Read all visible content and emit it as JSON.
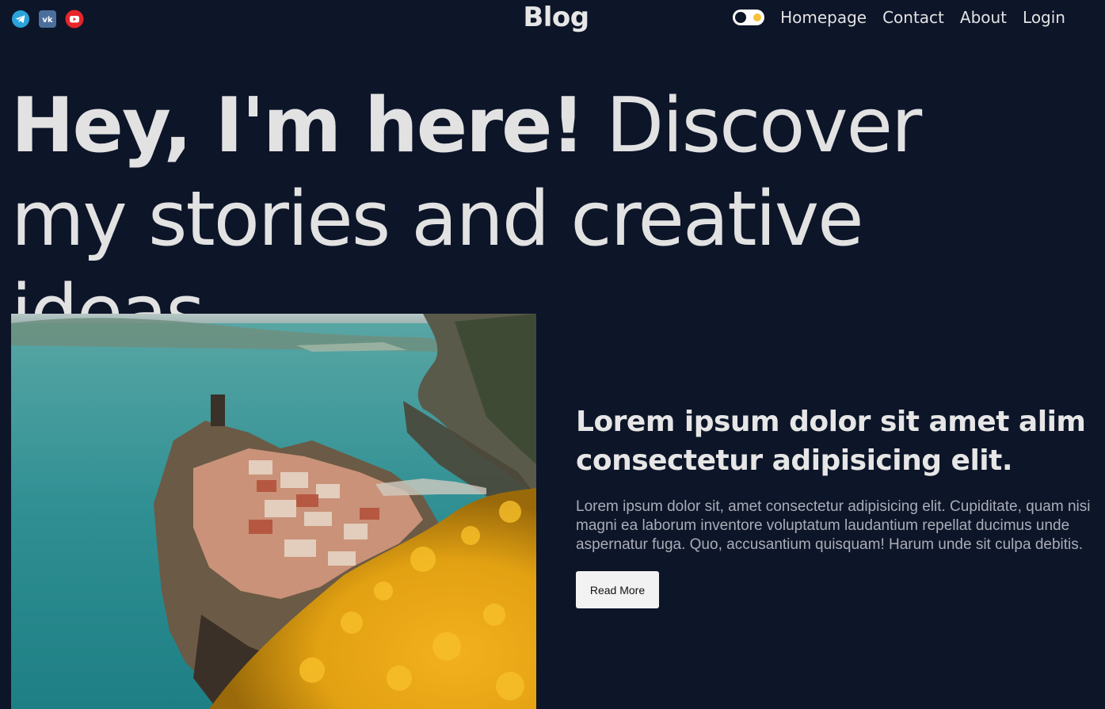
{
  "header": {
    "logo": "Blog",
    "social": [
      "telegram-icon",
      "vk-icon",
      "youtube-icon"
    ],
    "nav": [
      "Homepage",
      "Contact",
      "About",
      "Login"
    ]
  },
  "hero": {
    "bold": "Hey, I'm here!",
    "light": " Discover my stories and creative ideas."
  },
  "post": {
    "title": "Lorem ipsum dolor sit amet alim consectetur adipisicing elit.",
    "description": "Lorem ipsum dolor sit, amet consectetur adipisicing elit. Cupiditate, quam nisi magni ea laborum inventore voluptatum laudantium repellat ducimus unde aspernatur fuga. Quo, accusantium quisquam! Harum unde sit culpa debitis.",
    "button": "Read More"
  },
  "colors": {
    "background": "#0d1529",
    "text": "#e2e2e2",
    "muted": "#a9adb6",
    "telegram": "#2aa3db",
    "vk": "#4b6f9d",
    "youtube": "#e5262a",
    "toggle_sun": "#f5c23a"
  }
}
